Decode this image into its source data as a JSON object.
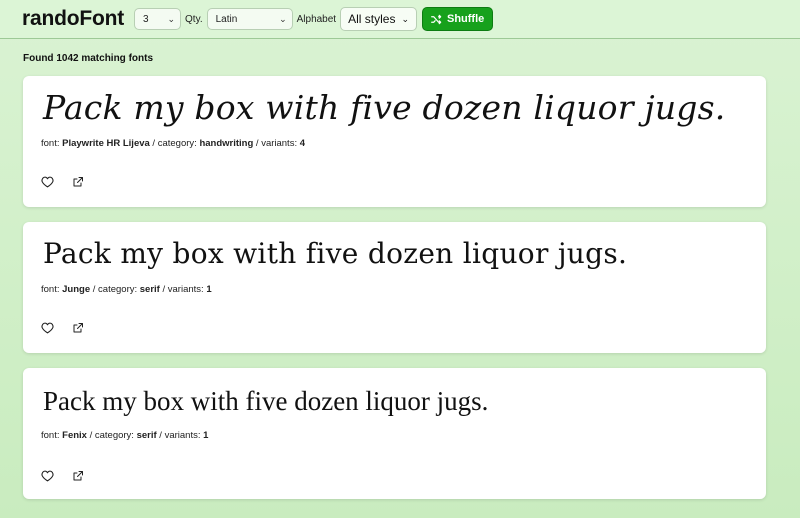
{
  "header": {
    "brand": "randoFont",
    "qty_value": "3",
    "qty_label": "Qty.",
    "alphabet_value": "Latin",
    "alphabet_label": "Alphabet",
    "styles_value": "All styles",
    "shuffle_label": "Shuffle"
  },
  "results": {
    "found_text": "Found 1042 matching fonts"
  },
  "labels": {
    "font": "font:",
    "category": "category:",
    "variants": "variants:",
    "sep": " / "
  },
  "cards": [
    {
      "sample": "Pack my box with five dozen liquor jugs.",
      "font": "Playwrite HR Lijeva",
      "category": "handwriting",
      "variants": "4"
    },
    {
      "sample": "Pack my box with five dozen liquor jugs.",
      "font": "Junge",
      "category": "serif",
      "variants": "1"
    },
    {
      "sample": "Pack my box with five dozen liquor jugs.",
      "font": "Fenix",
      "category": "serif",
      "variants": "1"
    }
  ],
  "icons": {
    "favorite": "heart-icon",
    "open": "external-link-icon",
    "shuffle": "shuffle-icon",
    "dropdown": "chevron-down-icon"
  },
  "colors": {
    "accent": "#17a11c",
    "background": "#d4f0cc"
  }
}
